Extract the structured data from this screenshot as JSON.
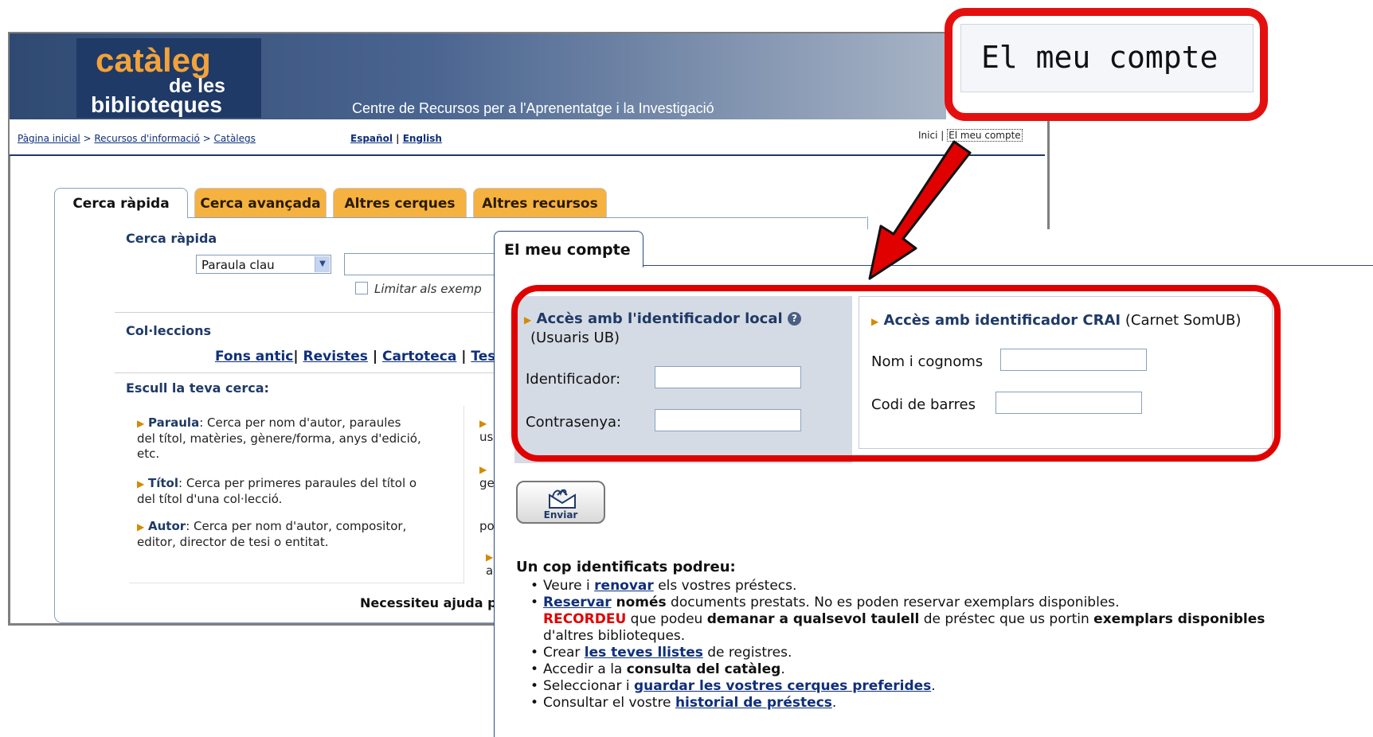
{
  "header": {
    "logo_line1": "catàleg",
    "logo_line2": "de les",
    "logo_line3": "biblioteques",
    "subtitle": "Centre de Recursos per a l'Aprenentatge i la Investigació"
  },
  "breadcrumb": {
    "home": "Pàgina inicial",
    "sep1": " > ",
    "resources": "Recursos d'informació",
    "sep2": " > ",
    "catalogs": "Catàlegs"
  },
  "languages": {
    "es": "Español",
    "sep": " | ",
    "en": "English"
  },
  "top_links": {
    "inici": "Inici",
    "sep": "|",
    "account": "El meu compte"
  },
  "tabs": [
    {
      "label": "Cerca ràpida"
    },
    {
      "label": "Cerca avançada"
    },
    {
      "label": "Altres cerques"
    },
    {
      "label": "Altres recursos"
    }
  ],
  "quick_search": {
    "heading": "Cerca ràpida",
    "select_value": "Paraula clau",
    "limit_label": "Limitar als exemp"
  },
  "collections": {
    "heading": "Col·leccions",
    "items": [
      "Fons antic",
      "Revistes",
      "Cartoteca",
      "Tesis"
    ],
    "seps": [
      "|",
      " | ",
      " | "
    ]
  },
  "choose": {
    "heading": "Escull la teva cerca:",
    "items": [
      {
        "term": "Paraula",
        "desc1": ": Cerca per nom d'autor, paraules",
        "desc2": "del títol, matèries, gènere/forma, anys d'edició,",
        "desc3": "etc."
      },
      {
        "term": "Títol",
        "desc1": ": Cerca per primeres paraules del títol o",
        "desc2": "del títol d'una col·lecció."
      },
      {
        "term": "Autor",
        "desc1": ": Cerca per nom d'autor, compositor,",
        "desc2": "editor, director de tesi o entitat."
      }
    ],
    "right_fragments": [
      "us",
      "ge",
      "po",
      "al"
    ]
  },
  "help_text": "Necessiteu ajuda p",
  "popup": {
    "tab_label": "El meu compte",
    "local": {
      "title": "Accès amb l'identificador local",
      "subtitle": "(Usuaris UB)",
      "id_label": "Identificador:",
      "pw_label": "Contrasenya:"
    },
    "crai": {
      "title": "Accès amb identificador CRAI",
      "title_suffix": " (Carnet SomUB)",
      "name_label": "Nom i cognoms",
      "barcode_label": "Codi de barres"
    },
    "submit_label": "Enviar",
    "info_heading": "Un cop identificats podreu:",
    "bullets": {
      "b1_pre": "Veure i ",
      "b1_link": "renovar",
      "b1_post": " els vostres préstecs.",
      "b2_link": "Reservar",
      "b2_bold": " només",
      "b2_post": " documents prestats. No es poden reservar exemplars disponibles.",
      "b2_red": "RECORDEU",
      "b2_mid": " que podeu ",
      "b2_bold2": "demanar a qualsevol taulell",
      "b2_mid2": " de préstec que us portin ",
      "b2_bold3": "exemplars disponibles",
      "b2_end": "d'altres biblioteques.",
      "b3_pre": "Crear ",
      "b3_link": "les teves llistes",
      "b3_post": " de registres.",
      "b4_pre": "Accedir a la ",
      "b4_bold": "consulta del catàleg",
      "b4_post": ".",
      "b5_pre": "Seleccionar i ",
      "b5_link": "guardar les vostres cerques preferides",
      "b5_post": ".",
      "b6_pre": "Consultar el vostre ",
      "b6_link": "historial de préstecs",
      "b6_post": "."
    }
  },
  "callout": {
    "text": "El meu compte"
  },
  "colors": {
    "highlight_red": "#e00000",
    "tab_orange": "#f5b240",
    "link_blue": "#0f2f7a",
    "panel_grey": "#d5dbe5"
  }
}
